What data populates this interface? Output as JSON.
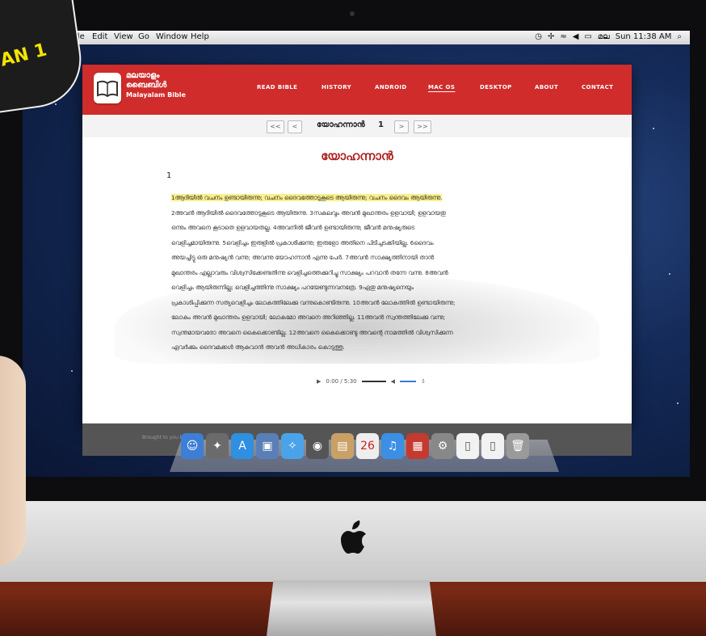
{
  "menubar": {
    "items": [
      "File",
      "Edit",
      "View",
      "Go",
      "Window",
      "Help"
    ],
    "clock": "Sun 11:38 AM",
    "lang": "മല"
  },
  "badge": {
    "text": "AN 1"
  },
  "site": {
    "brand_line1": "മലയാളം",
    "brand_line2": "ബൈബിൾ",
    "brand_line3": "Malayalam Bible",
    "nav": [
      "READ BIBLE",
      "HISTORY",
      "ANDROID",
      "MAC OS",
      "DESKTOP",
      "ABOUT",
      "CONTACT"
    ],
    "active_nav": "MAC OS",
    "accent": "#cf2c2b"
  },
  "pager": {
    "first": "<<",
    "prev": "<",
    "book": "യോഹന്നാൻ",
    "chapter": "1",
    "next": ">",
    "last": ">>"
  },
  "chapter": {
    "title": "യോഹന്നാൻ",
    "number": "1",
    "verses": [
      "1ആദിയിൽ വചനം ഉണ്ടായിരുന്നു; വചനം ദൈവത്തോടുകൂടെ ആയിരുന്നു; വചനം ദൈവം ആയിരുന്നു.",
      "2അവൻ ആദിയിൽ ദൈവത്തോടുകൂടെ ആയിരുന്നു. 3സകലവും അവൻ മുഖാന്തരം ഉളവായി; ഉളവായതു",
      "ഒന്നും അവനെ കൂടാതെ ഉളവായതല്ല. 4അവനിൽ ജീവൻ ഉണ്ടായിരുന്നു; ജീവൻ മനുഷ്യരുടെ",
      "വെളിച്ചമായിരുന്നു. 5വെളിച്ചം ഇരുളിൽ പ്രകാശിക്കുന്നു; ഇരുളോ അതിനെ പിടിച്ചടക്കിയില്ല. 6ദൈവം",
      "അയച്ചിട്ടു ഒരു മനുഷ്യൻ വന്നു; അവന്നു യോഹന്നാൻ എന്നു പേർ. 7അവൻ സാക്ഷ്യത്തിനായി താൻ",
      "മുഖാന്തരം എല്ലാവരും വിശ്വസിക്കേണ്ടതിന്നു വെളിച്ചത്തെക്കുറിച്ചു സാക്ഷ്യം പറവാൻ തന്നേ വന്നു. 8അവൻ",
      "വെളിച്ചം ആയിരുന്നില്ല; വെളിച്ചത്തിന്നു സാക്ഷ്യം പറയേണ്ടുന്നവനത്രേ. 9ഏതു മനുഷ്യനെയും",
      "പ്രകാശിപ്പിക്കുന്ന സത്യവെളിച്ചം ലോകത്തിലേക്കു വന്നുകൊണ്ടിരുന്നു. 10അവൻ ലോകത്തിൽ ഉണ്ടായിരുന്നു;",
      "ലോകം അവൻ മുഖാന്തരം ഉളവായി; ലോകമോ അവനെ അറിഞ്ഞില്ല. 11അവൻ സ്വന്തത്തിലേക്കു വന്നു;",
      "സ്വന്തമായവരോ അവനെ കൈക്കൊണ്ടില്ല. 12അവനെ കൈക്കൊണ്ടു അവന്റെ നാമത്തിൽ വിശ്വസിക്കുന്ന",
      "ഏവർക്കും ദൈവമക്കൾ ആകുവാൻ അവൻ അധികാരം കൊടുത്തു."
    ]
  },
  "player": {
    "time": "0:00 / 5:30"
  },
  "footer": {
    "text": "Brought to you by"
  }
}
